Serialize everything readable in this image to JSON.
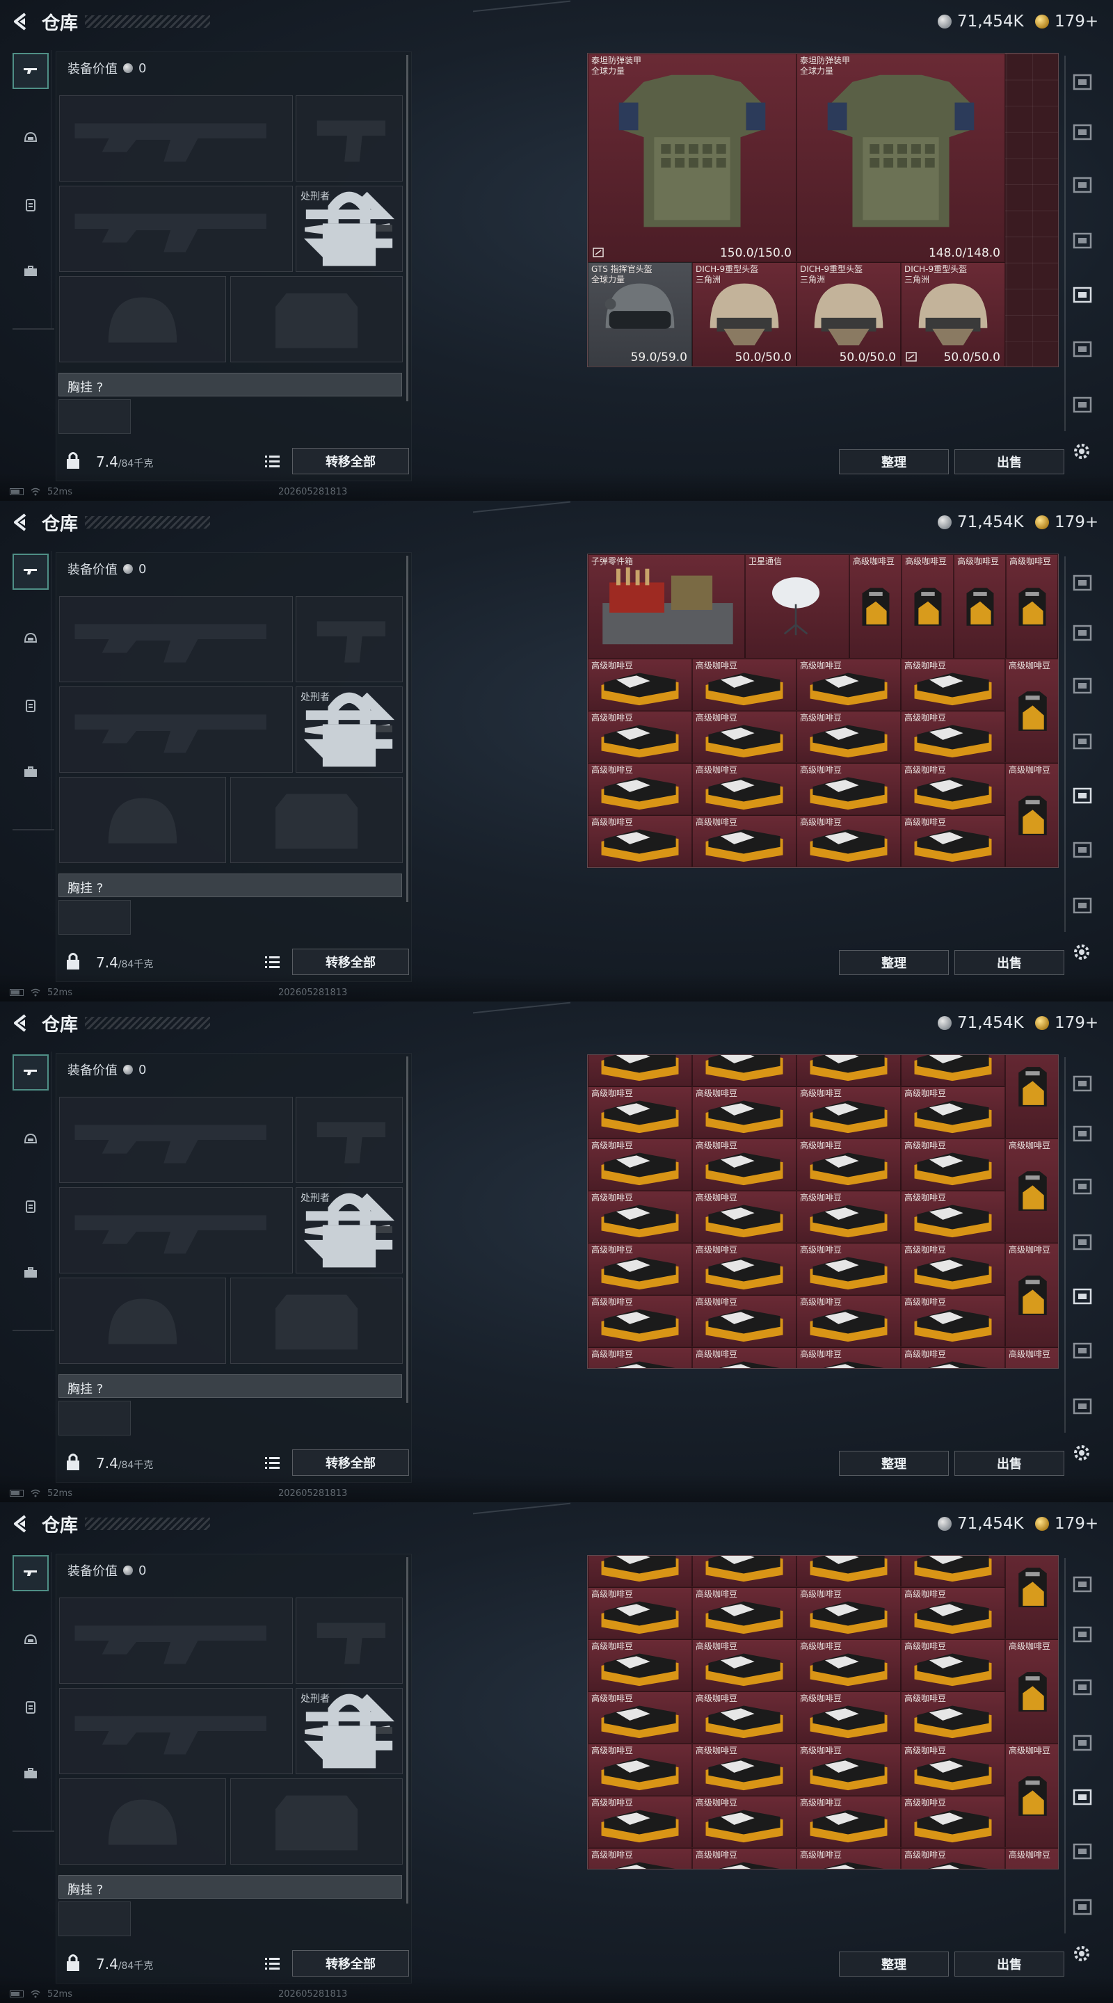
{
  "header": {
    "title": "仓库",
    "currency_silver": "71,454K",
    "currency_gold": "179+"
  },
  "equipment": {
    "value_label": "装备价值",
    "value": "0",
    "melee_slot_label": "处刑者",
    "chest_rig_label": "胸挂  ?",
    "weight_current": "7.4",
    "weight_capacity": "/84千克",
    "transfer_all": "转移全部"
  },
  "storage": {
    "sort_button": "整理",
    "sell_button": "出售",
    "screen1_items": [
      {
        "name": "泰坦防弹装甲\n全球力量",
        "durability": "150.0/150.0"
      },
      {
        "name": "泰坦防弹装甲\n全球力量",
        "durability": "148.0/148.0"
      },
      {
        "name": "GTS 指挥官头盔\n全球力量",
        "durability": "59.0/59.0"
      },
      {
        "name": "DICH-9重型头盔\n三角洲",
        "durability": "50.0/50.0"
      },
      {
        "name": "DICH-9重型头盔\n三角洲",
        "durability": "50.0/50.0"
      },
      {
        "name": "DICH-9重型头盔\n三角洲",
        "durability": "50.0/50.0"
      }
    ],
    "screen2_top_items": [
      {
        "name": "子弹零件箱"
      },
      {
        "name": "卫星通信"
      }
    ],
    "coffee_bag_label": "高级咖啡豆",
    "coffee_box_label": "高级咖啡豆"
  },
  "status": {
    "ping": "52ms",
    "build": "202605281813"
  },
  "icons": [
    "back-icon",
    "rifle-icon",
    "helmet-icon",
    "backpack-icon",
    "briefcase-icon",
    "lock-icon",
    "list-icon",
    "swap-icon",
    "gear-icon",
    "silver-coin-icon",
    "gold-coin-icon"
  ],
  "colors": {
    "accent_teal": "#4f8f86",
    "storage_bg": "#3a1b21",
    "item_rare": "#6a2a35"
  }
}
